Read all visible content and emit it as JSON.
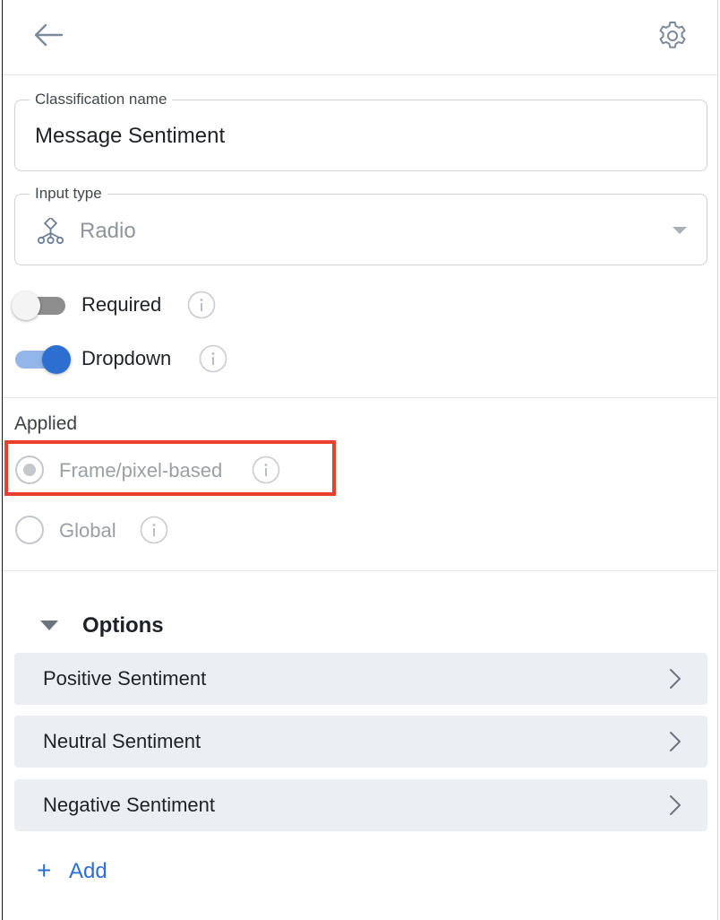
{
  "header": {
    "back_icon": "arrow-left-icon",
    "settings_icon": "gear-icon"
  },
  "classification_name": {
    "label": "Classification name",
    "value": "Message Sentiment"
  },
  "input_type": {
    "label": "Input type",
    "icon": "radio-tree-icon",
    "value": "Radio"
  },
  "toggles": {
    "required": {
      "label": "Required",
      "on": false
    },
    "dropdown": {
      "label": "Dropdown",
      "on": true
    }
  },
  "applied": {
    "label": "Applied",
    "options": [
      {
        "label": "Frame/pixel-based",
        "selected": true,
        "disabled": true
      },
      {
        "label": "Global",
        "selected": false,
        "disabled": true
      }
    ]
  },
  "highlight_color": "#e8402c",
  "options_section": {
    "title": "Options",
    "items": [
      {
        "label": "Positive Sentiment"
      },
      {
        "label": "Neutral Sentiment"
      },
      {
        "label": "Negative Sentiment"
      }
    ],
    "add_symbol": "+",
    "add_label": "Add"
  },
  "colors": {
    "accent": "#2d6fd0",
    "option_bg": "#ebeef2"
  }
}
